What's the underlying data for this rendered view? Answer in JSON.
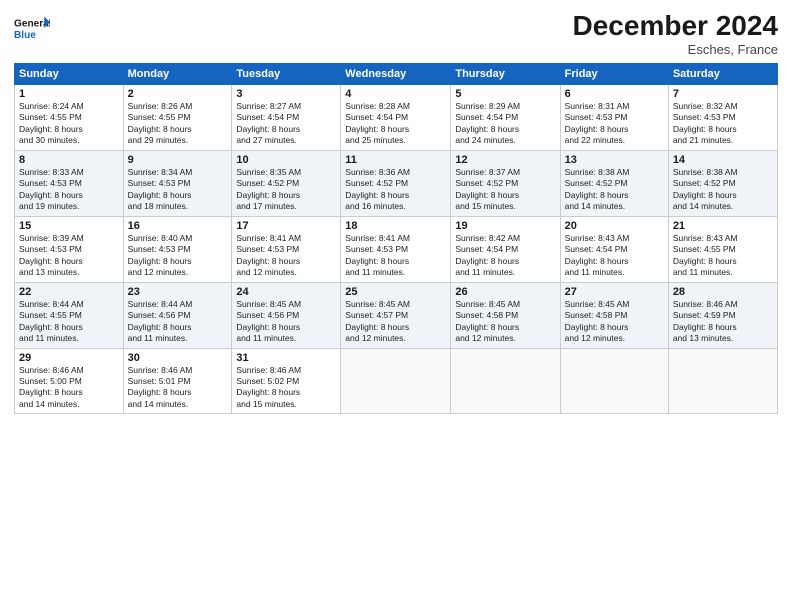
{
  "header": {
    "title": "December 2024",
    "location": "Esches, France"
  },
  "columns": [
    "Sunday",
    "Monday",
    "Tuesday",
    "Wednesday",
    "Thursday",
    "Friday",
    "Saturday"
  ],
  "weeks": [
    [
      {
        "day": "1",
        "info": "Sunrise: 8:24 AM\nSunset: 4:55 PM\nDaylight: 8 hours\nand 30 minutes."
      },
      {
        "day": "2",
        "info": "Sunrise: 8:26 AM\nSunset: 4:55 PM\nDaylight: 8 hours\nand 29 minutes."
      },
      {
        "day": "3",
        "info": "Sunrise: 8:27 AM\nSunset: 4:54 PM\nDaylight: 8 hours\nand 27 minutes."
      },
      {
        "day": "4",
        "info": "Sunrise: 8:28 AM\nSunset: 4:54 PM\nDaylight: 8 hours\nand 25 minutes."
      },
      {
        "day": "5",
        "info": "Sunrise: 8:29 AM\nSunset: 4:54 PM\nDaylight: 8 hours\nand 24 minutes."
      },
      {
        "day": "6",
        "info": "Sunrise: 8:31 AM\nSunset: 4:53 PM\nDaylight: 8 hours\nand 22 minutes."
      },
      {
        "day": "7",
        "info": "Sunrise: 8:32 AM\nSunset: 4:53 PM\nDaylight: 8 hours\nand 21 minutes."
      }
    ],
    [
      {
        "day": "8",
        "info": "Sunrise: 8:33 AM\nSunset: 4:53 PM\nDaylight: 8 hours\nand 19 minutes."
      },
      {
        "day": "9",
        "info": "Sunrise: 8:34 AM\nSunset: 4:53 PM\nDaylight: 8 hours\nand 18 minutes."
      },
      {
        "day": "10",
        "info": "Sunrise: 8:35 AM\nSunset: 4:52 PM\nDaylight: 8 hours\nand 17 minutes."
      },
      {
        "day": "11",
        "info": "Sunrise: 8:36 AM\nSunset: 4:52 PM\nDaylight: 8 hours\nand 16 minutes."
      },
      {
        "day": "12",
        "info": "Sunrise: 8:37 AM\nSunset: 4:52 PM\nDaylight: 8 hours\nand 15 minutes."
      },
      {
        "day": "13",
        "info": "Sunrise: 8:38 AM\nSunset: 4:52 PM\nDaylight: 8 hours\nand 14 minutes."
      },
      {
        "day": "14",
        "info": "Sunrise: 8:38 AM\nSunset: 4:52 PM\nDaylight: 8 hours\nand 14 minutes."
      }
    ],
    [
      {
        "day": "15",
        "info": "Sunrise: 8:39 AM\nSunset: 4:53 PM\nDaylight: 8 hours\nand 13 minutes."
      },
      {
        "day": "16",
        "info": "Sunrise: 8:40 AM\nSunset: 4:53 PM\nDaylight: 8 hours\nand 12 minutes."
      },
      {
        "day": "17",
        "info": "Sunrise: 8:41 AM\nSunset: 4:53 PM\nDaylight: 8 hours\nand 12 minutes."
      },
      {
        "day": "18",
        "info": "Sunrise: 8:41 AM\nSunset: 4:53 PM\nDaylight: 8 hours\nand 11 minutes."
      },
      {
        "day": "19",
        "info": "Sunrise: 8:42 AM\nSunset: 4:54 PM\nDaylight: 8 hours\nand 11 minutes."
      },
      {
        "day": "20",
        "info": "Sunrise: 8:43 AM\nSunset: 4:54 PM\nDaylight: 8 hours\nand 11 minutes."
      },
      {
        "day": "21",
        "info": "Sunrise: 8:43 AM\nSunset: 4:55 PM\nDaylight: 8 hours\nand 11 minutes."
      }
    ],
    [
      {
        "day": "22",
        "info": "Sunrise: 8:44 AM\nSunset: 4:55 PM\nDaylight: 8 hours\nand 11 minutes."
      },
      {
        "day": "23",
        "info": "Sunrise: 8:44 AM\nSunset: 4:56 PM\nDaylight: 8 hours\nand 11 minutes."
      },
      {
        "day": "24",
        "info": "Sunrise: 8:45 AM\nSunset: 4:56 PM\nDaylight: 8 hours\nand 11 minutes."
      },
      {
        "day": "25",
        "info": "Sunrise: 8:45 AM\nSunset: 4:57 PM\nDaylight: 8 hours\nand 12 minutes."
      },
      {
        "day": "26",
        "info": "Sunrise: 8:45 AM\nSunset: 4:58 PM\nDaylight: 8 hours\nand 12 minutes."
      },
      {
        "day": "27",
        "info": "Sunrise: 8:45 AM\nSunset: 4:58 PM\nDaylight: 8 hours\nand 12 minutes."
      },
      {
        "day": "28",
        "info": "Sunrise: 8:46 AM\nSunset: 4:59 PM\nDaylight: 8 hours\nand 13 minutes."
      }
    ],
    [
      {
        "day": "29",
        "info": "Sunrise: 8:46 AM\nSunset: 5:00 PM\nDaylight: 8 hours\nand 14 minutes."
      },
      {
        "day": "30",
        "info": "Sunrise: 8:46 AM\nSunset: 5:01 PM\nDaylight: 8 hours\nand 14 minutes."
      },
      {
        "day": "31",
        "info": "Sunrise: 8:46 AM\nSunset: 5:02 PM\nDaylight: 8 hours\nand 15 minutes."
      },
      null,
      null,
      null,
      null
    ]
  ]
}
